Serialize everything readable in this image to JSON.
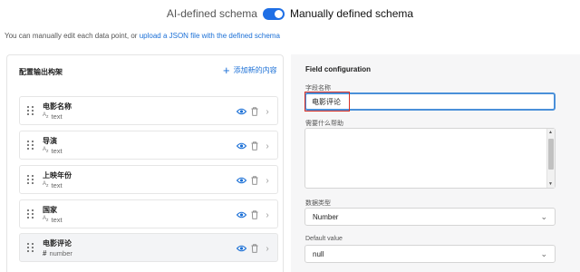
{
  "mode": {
    "left_label": "AI-defined schema",
    "right_label": "Manually defined schema",
    "toggle_on": true,
    "accent": "#1f6fe5"
  },
  "intro": {
    "text": "You can manually edit each data point, or ",
    "link": "upload a JSON file with the defined schema"
  },
  "left_panel": {
    "title": "配置输出构架",
    "add_label": "添加新的内容",
    "fields": [
      {
        "name": "电影名称",
        "type": "text",
        "type_icon": "text-type-icon"
      },
      {
        "name": "导演",
        "type": "text",
        "type_icon": "text-type-icon"
      },
      {
        "name": "上映年份",
        "type": "text",
        "type_icon": "text-type-icon"
      },
      {
        "name": "国家",
        "type": "text",
        "type_icon": "text-type-icon"
      },
      {
        "name": "电影评论",
        "type": "number",
        "type_icon": "number-type-icon",
        "selected": true
      }
    ]
  },
  "right_panel": {
    "title": "Field configuration",
    "name_label": "字段名称",
    "name_value": "电影评论",
    "help_label": "需要什么帮助",
    "help_value": "",
    "type_label": "数据类型",
    "type_value": "Number",
    "default_label": "Default value",
    "default_value": "null"
  },
  "icons": {
    "toggle": "toggle-switch-icon",
    "add": "plus-icon",
    "drag": "drag-handle-icon",
    "eye": "eye-icon",
    "trash": "trash-icon",
    "chevron": "chevron-right-icon",
    "select": "chevron-down-icon"
  },
  "colors": {
    "link": "#1a6fd6",
    "highlight": "#d93025",
    "focus": "#4a90d9"
  }
}
